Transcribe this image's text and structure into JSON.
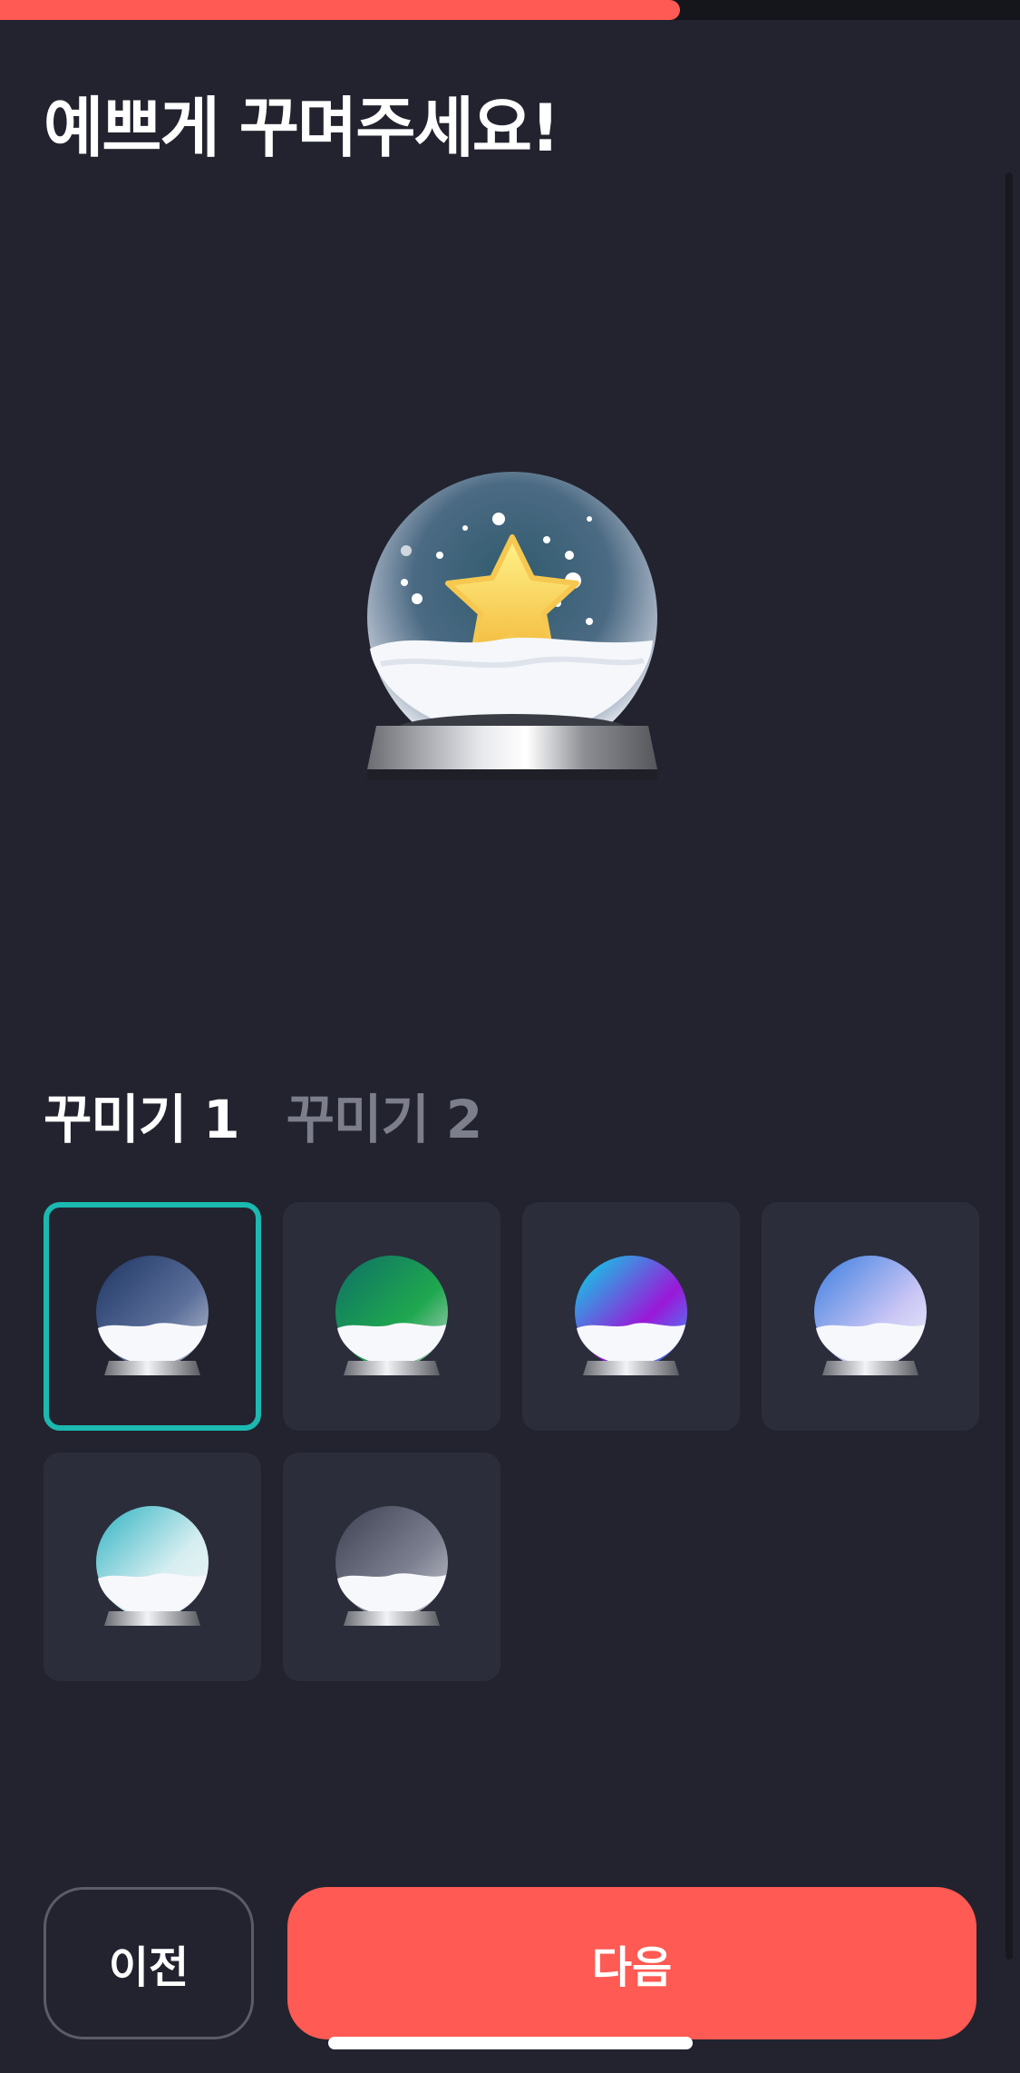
{
  "progress": {
    "value_percent": 66.7,
    "color": "#ff5a53"
  },
  "page_title": "예쁘게 꾸며주세요!",
  "tabs": [
    {
      "label": "꾸미기 1",
      "active": true
    },
    {
      "label": "꾸미기 2",
      "active": false
    }
  ],
  "preview": {
    "icon": "snow-globe-star-icon"
  },
  "options": [
    {
      "name": "navy-globe-icon",
      "selected": true,
      "colors": [
        "#1e3563",
        "#5b6f9a",
        "#c7ccd8"
      ]
    },
    {
      "name": "green-globe-icon",
      "selected": false,
      "colors": [
        "#0e6f66",
        "#1fa84f",
        "#c8d7d2"
      ]
    },
    {
      "name": "neon-globe-icon",
      "selected": false,
      "colors": [
        "#00e0e8",
        "#9a18d8",
        "#2fa7ff"
      ]
    },
    {
      "name": "blue-pastel-globe-icon",
      "selected": false,
      "colors": [
        "#3a7ee0",
        "#c7c4f5",
        "#f2f2f7"
      ]
    },
    {
      "name": "mint-globe-icon",
      "selected": false,
      "colors": [
        "#2fb3c2",
        "#d6eef1",
        "#f5f7f7"
      ]
    },
    {
      "name": "gray-globe-icon",
      "selected": false,
      "colors": [
        "#3c4050",
        "#7d8090",
        "#c8cad2"
      ]
    }
  ],
  "buttons": {
    "prev": "이전",
    "next": "다음"
  },
  "colors": {
    "background": "#22232e",
    "accent": "#ff5a53",
    "selected_border": "#1bb9b0"
  }
}
